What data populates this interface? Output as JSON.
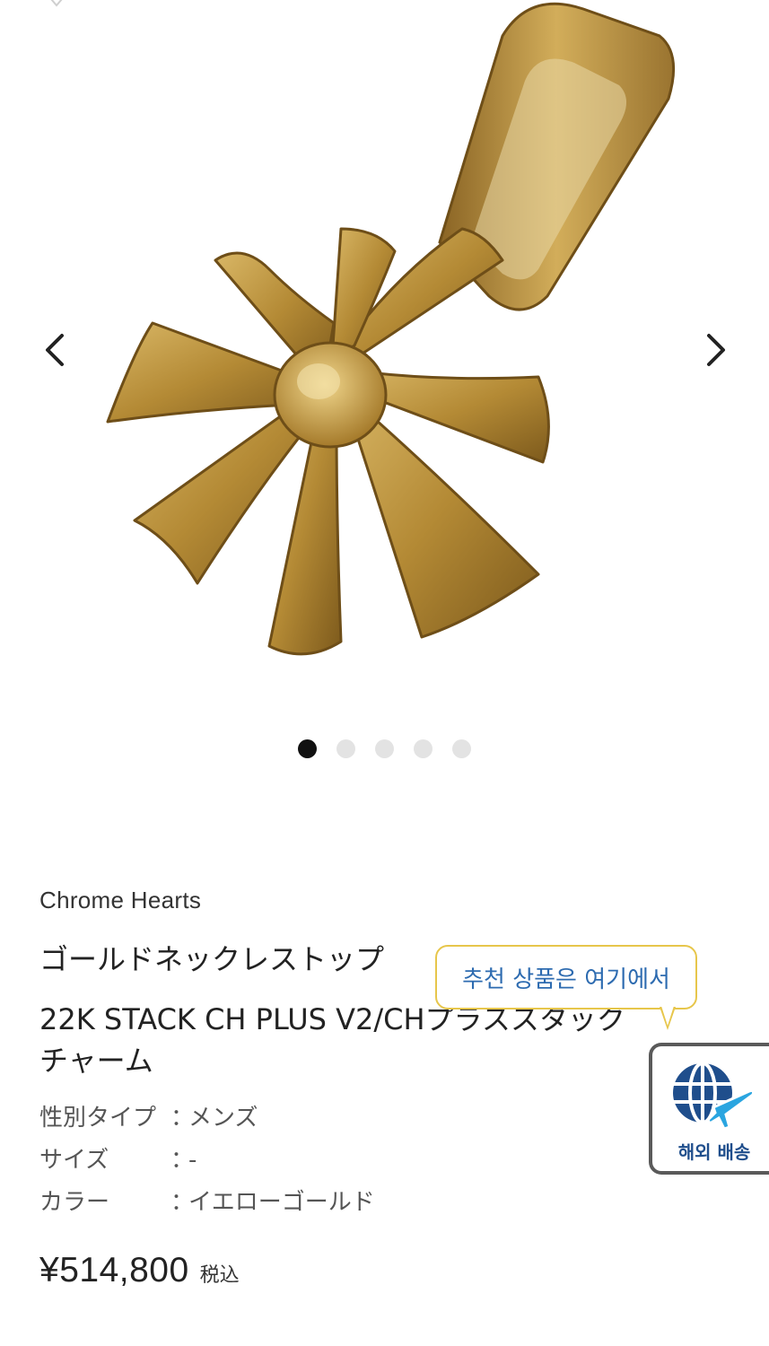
{
  "product": {
    "brand": "Chrome Hearts",
    "name_line1": "ゴールドネックレストップ",
    "name_line2": "22K STACK CH PLUS V2/CHプラススタック",
    "name_line3": "チャーム",
    "specs": [
      {
        "label": "性別タイプ",
        "sep": "：",
        "value": "メンズ"
      },
      {
        "label": "サイズ",
        "sep": "：",
        "value": "-"
      },
      {
        "label": "カラー",
        "sep": "：",
        "value": "イエローゴールド"
      }
    ],
    "price": "¥514,800",
    "tax_note": "税込"
  },
  "gallery": {
    "total_images": 5,
    "current_index": 1,
    "icons": {
      "prev": "chevron-left-icon",
      "next": "chevron-right-icon",
      "favorite": "heart-icon"
    }
  },
  "tooltip": {
    "text": "추천 상품은 여기에서"
  },
  "overseas_shipping": {
    "label": "해외 배송",
    "icon": "globe-plane-icon"
  },
  "colors": {
    "accent_blue": "#2d6bb0",
    "tooltip_border": "#e7c64b",
    "dot_active": "#111111",
    "dot_inactive": "#e3e3e3",
    "gold": "#c9a24a"
  }
}
